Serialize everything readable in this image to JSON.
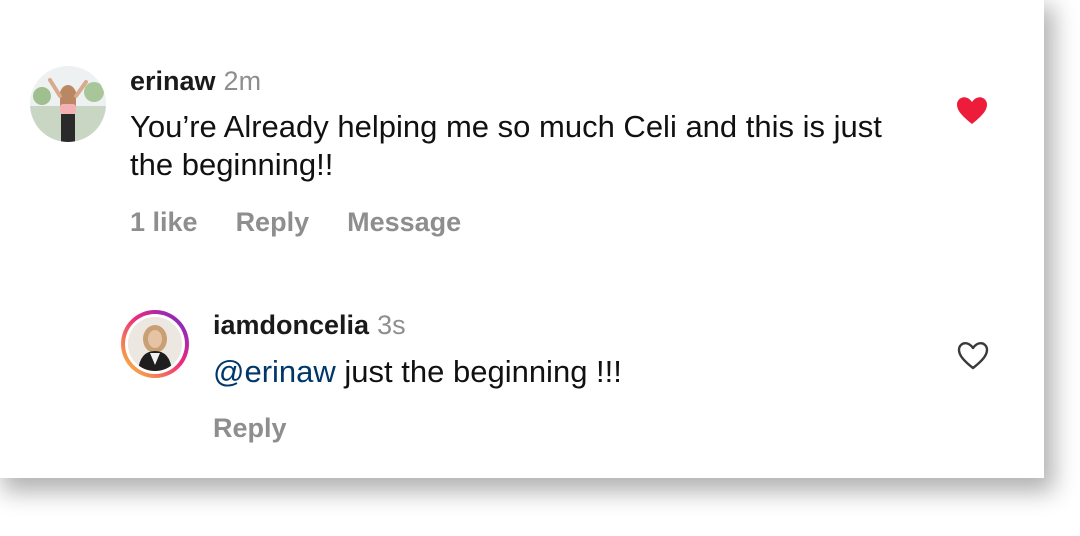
{
  "comment": {
    "username": "erinaw",
    "time": "2m",
    "text": "You’re Already helping me so much Celi and this is just the beginning!!",
    "like_count": "1 like",
    "reply_label": "Reply",
    "message_label": "Message",
    "liked": true,
    "like_color": "#ed1c3a",
    "avatar_icon": "user-photo"
  },
  "reply": {
    "username": "iamdoncelia",
    "time": "3s",
    "mention": "@erinaw",
    "text": " just the beginning !!!",
    "reply_label": "Reply",
    "liked": false,
    "avatar_icon": "story-ring-user-photo",
    "mention_color": "#00376b"
  }
}
